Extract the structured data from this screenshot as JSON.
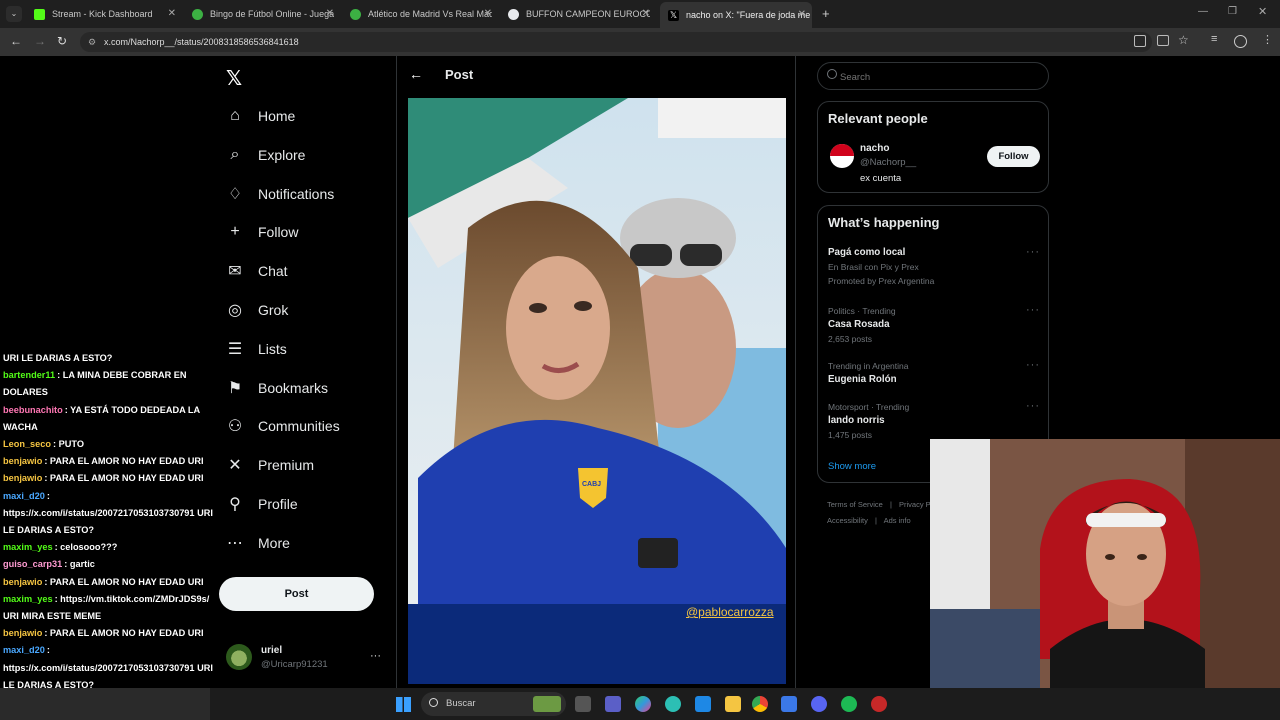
{
  "browser": {
    "tabs": [
      {
        "title": "Stream - Kick Dashboard",
        "color": "#53fc18"
      },
      {
        "title": "Bingo de Fútbol Online - Juega",
        "color": "#3cb043"
      },
      {
        "title": "Atlético de Madrid Vs Real Mad",
        "color": "#3cb043"
      },
      {
        "title": "BUFFON CAMPEON EUROCOPA",
        "color": "#e8eaed"
      },
      {
        "title": "nacho on X: \"Fuera de joda me",
        "color": "#ffffff"
      }
    ],
    "url": "x.com/Nachorp__/status/2008318586536841618"
  },
  "chat": {
    "messages": [
      {
        "user": "",
        "text": "URI LE DARIAS A ESTO?",
        "color": "#ffffff"
      },
      {
        "user": "bartender11",
        "text": ": LA MINA DEBE COBRAR EN DOLARES",
        "color": "#53fc18"
      },
      {
        "user": "beebunachito",
        "text": ": YA ESTÁ TODO DEDEADA LA WACHA",
        "color": "#ff77b4"
      },
      {
        "user": "Leon_seco",
        "text": ": PUTO",
        "color": "#f5c542"
      },
      {
        "user": "benjawio",
        "text": ": PARA EL AMOR NO HAY EDAD URI",
        "color": "#f5c542"
      },
      {
        "user": "benjawio",
        "text": ": PARA EL AMOR NO HAY EDAD URI",
        "color": "#f5c542"
      },
      {
        "user": "maxi_d20",
        "text": ": https://x.com/i/status/2007217053103730791 URI LE DARIAS A ESTO?",
        "color": "#4aa8ff"
      },
      {
        "user": "maxim_yes",
        "text": ": celosooo???",
        "color": "#53fc18"
      },
      {
        "user": "guiso_carp31",
        "text": ": gartic",
        "color": "#ff9bd2"
      },
      {
        "user": "benjawio",
        "text": ": PARA EL AMOR NO HAY EDAD URI",
        "color": "#f5c542"
      },
      {
        "user": "maxim_yes",
        "text": ": https://vm.tiktok.com/ZMDrJDS9s/ URI MIRA ESTE MEME",
        "color": "#53fc18"
      },
      {
        "user": "benjawio",
        "text": ": PARA EL AMOR NO HAY EDAD URI",
        "color": "#f5c542"
      },
      {
        "user": "maxi_d20",
        "text": ": https://x.com/i/status/2007217053103730791 URI LE DARIAS A ESTO?",
        "color": "#4aa8ff"
      }
    ]
  },
  "nav": {
    "items": [
      {
        "label": "Home",
        "icon": "home-icon"
      },
      {
        "label": "Explore",
        "icon": "search-icon"
      },
      {
        "label": "Notifications",
        "icon": "bell-icon"
      },
      {
        "label": "Follow",
        "icon": "add-person-icon"
      },
      {
        "label": "Chat",
        "icon": "mail-icon"
      },
      {
        "label": "Grok",
        "icon": "grok-icon"
      },
      {
        "label": "Lists",
        "icon": "list-icon"
      },
      {
        "label": "Bookmarks",
        "icon": "bookmark-icon"
      },
      {
        "label": "Communities",
        "icon": "people-icon"
      },
      {
        "label": "Premium",
        "icon": "x-icon"
      },
      {
        "label": "Profile",
        "icon": "person-icon"
      },
      {
        "label": "More",
        "icon": "more-icon"
      }
    ],
    "post_label": "Post",
    "account": {
      "name": "uriel",
      "handle": "@Uricarp91231"
    }
  },
  "post": {
    "header": "Post",
    "watermark": "@pablocarrozza",
    "jersey_text": "CABJ"
  },
  "right": {
    "search_placeholder": "Search",
    "relevant": {
      "title": "Relevant people",
      "name": "nacho",
      "handle": "@Nachorp__",
      "bio": "ex cuenta",
      "follow": "Follow"
    },
    "happening": {
      "title": "What’s happening",
      "items": [
        {
          "meta": "",
          "title": "Pagá como local",
          "sub": "En Brasil con Pix y Prex",
          "promo": "Promoted by Prex Argentina"
        },
        {
          "meta": "Politics · Trending",
          "title": "Casa Rosada",
          "sub": "2,653 posts",
          "promo": ""
        },
        {
          "meta": "Trending in Argentina",
          "title": "Eugenia Rolón",
          "sub": "",
          "promo": ""
        },
        {
          "meta": "Motorsport · Trending",
          "title": "lando norris",
          "sub": "1,475 posts",
          "promo": ""
        }
      ],
      "show_more": "Show more"
    },
    "footer": [
      "Terms of Service",
      "Privacy Po",
      "Accessibility",
      "Ads info"
    ]
  },
  "taskbar": {
    "search": "Buscar"
  }
}
